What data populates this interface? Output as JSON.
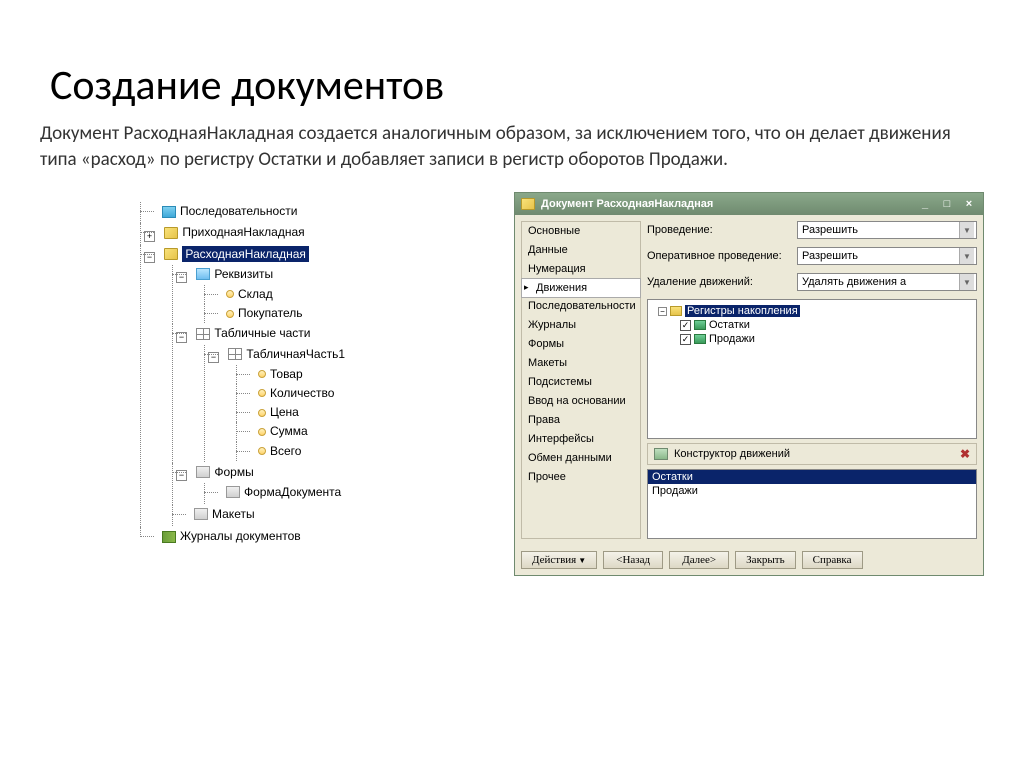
{
  "title": "Создание документов",
  "description": "Документ РасходнаяНакладная создается аналогичным образом, за исключением того, что он делает движения типа «расход» по регистру Остатки и добавляет записи в регистр оборотов Продажи.",
  "tree": {
    "seq": "Последовательности",
    "inbound": "ПриходнаяНакладная",
    "outbound": "РасходнаяНакладная",
    "props": "Реквизиты",
    "warehouse": "Склад",
    "buyer": "Покупатель",
    "tabs": "Табличные части",
    "tab1": "ТабличнаяЧасть1",
    "product": "Товар",
    "qty": "Количество",
    "price": "Цена",
    "sum": "Сумма",
    "total": "Всего",
    "forms": "Формы",
    "docform": "ФормаДокумента",
    "layouts": "Макеты",
    "journals": "Журналы документов"
  },
  "dlg": {
    "title": "Документ РасходнаяНакладная",
    "nav": {
      "main": "Основные",
      "data": "Данные",
      "numbering": "Нумерация",
      "movements": "Движения",
      "seq": "Последовательности",
      "journals": "Журналы",
      "forms": "Формы",
      "layouts": "Макеты",
      "subsystems": "Подсистемы",
      "input": "Ввод на основании",
      "rights": "Права",
      "interfaces": "Интерфейсы",
      "exchange": "Обмен данными",
      "other": "Прочее"
    },
    "fields": {
      "posting_label": "Проведение:",
      "posting_value": "Разрешить",
      "oper_label": "Оперативное проведение:",
      "oper_value": "Разрешить",
      "delete_label": "Удаление движений:",
      "delete_value": "Удалять движения а"
    },
    "registers": {
      "root": "Регистры накопления",
      "balances": "Остатки",
      "sales": "Продажи"
    },
    "constructor": "Конструктор движений",
    "list": {
      "balances": "Остатки",
      "sales": "Продажи"
    },
    "buttons": {
      "actions": "Действия",
      "back": "<Назад",
      "next": "Далее>",
      "close": "Закрыть",
      "help": "Справка"
    }
  }
}
